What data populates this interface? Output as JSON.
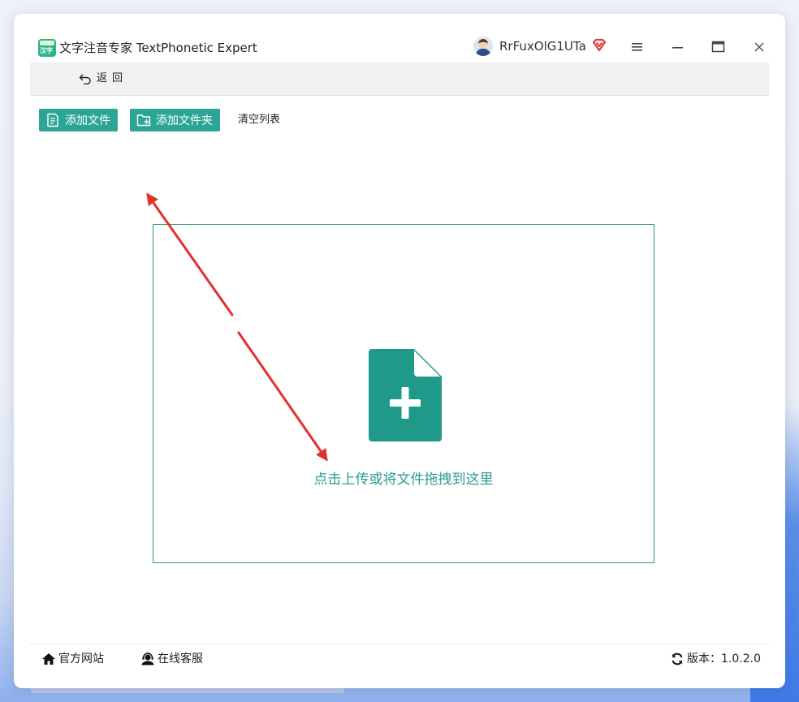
{
  "window": {
    "app_title": "文字注音专家 TextPhonetic Expert",
    "logo_text": "汉字"
  },
  "user": {
    "name": "RrFuxOlG1UTa"
  },
  "toolbar": {
    "back_label": "返回"
  },
  "actions": {
    "add_file_label": "添加文件",
    "add_folder_label": "添加文件夹",
    "clear_list_label": "清空列表"
  },
  "dropzone": {
    "text": "点击上传或将文件拖拽到这里"
  },
  "footer": {
    "website_label": "官方网站",
    "support_label": "在线客服",
    "version_label": "版本：1.0.2.0"
  },
  "colors": {
    "accent": "#2ca597",
    "dropzone_border": "#2b9488",
    "dropzone_text": "#2b9c8e",
    "annotation_arrow": "#e2312a",
    "vip_badge": "#e0383c"
  },
  "icons": {
    "back": "undo-arrow-icon",
    "add_file": "file-list-icon",
    "add_folder": "folder-plus-icon",
    "drop": "file-plus-icon",
    "website": "home-icon",
    "support": "headset-user-icon",
    "version": "refresh-icon",
    "vip": "vip-diamond-icon",
    "menu": "hamburger-icon",
    "minimize": "minimize-icon",
    "maximize": "maximize-icon",
    "close": "close-icon"
  }
}
